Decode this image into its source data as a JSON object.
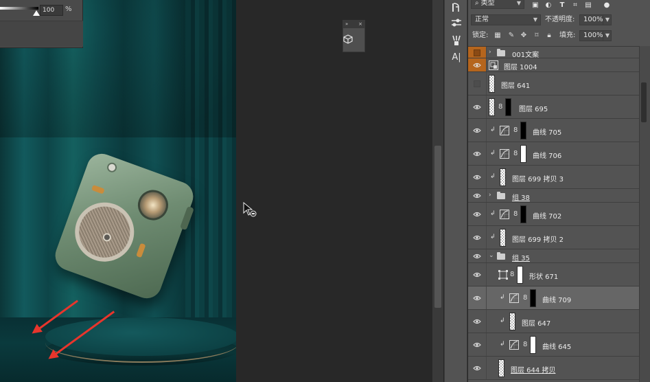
{
  "options_panel": {
    "value": "100",
    "unit": "%"
  },
  "layers_panel": {
    "filter_kind": "类型",
    "blend_mode": "正常",
    "opacity_label": "不透明度:",
    "opacity_value": "100%",
    "lock_label": "锁定:",
    "fill_label": "填充:",
    "fill_value": "100%",
    "layers": [
      {
        "name": "001文案",
        "kind": "group",
        "visible": false,
        "expanded": false,
        "tinted": true
      },
      {
        "name": "图层 1004",
        "kind": "smart",
        "visible": true,
        "tinted": true
      },
      {
        "name": "图层 641",
        "kind": "pixel",
        "visible": false
      },
      {
        "name": "图层 695",
        "kind": "pixel-mask",
        "visible": true
      },
      {
        "name": "曲线 705",
        "kind": "curves",
        "visible": true,
        "mask": "black",
        "clipped": true
      },
      {
        "name": "曲线 706",
        "kind": "curves",
        "visible": true,
        "mask": "white",
        "clipped": true
      },
      {
        "name": "图层 699 拷贝 3",
        "kind": "pixel",
        "visible": true,
        "clipped": true
      },
      {
        "name": "组 38",
        "kind": "group",
        "visible": true,
        "expanded": false,
        "underline": true
      },
      {
        "name": "曲线 702",
        "kind": "curves",
        "visible": true,
        "mask": "black",
        "clipped": true
      },
      {
        "name": "图层 699 拷贝 2",
        "kind": "pixel",
        "visible": true,
        "clipped": true
      },
      {
        "name": "组 35",
        "kind": "group",
        "visible": true,
        "expanded": true,
        "underline": true
      },
      {
        "name": "形状 671",
        "kind": "shape",
        "visible": true
      },
      {
        "name": "曲线 709",
        "kind": "curves",
        "visible": true,
        "mask": "black",
        "clipped": true,
        "selected": true
      },
      {
        "name": "图层 647",
        "kind": "pixel",
        "visible": true,
        "clipped": true
      },
      {
        "name": "曲线 645",
        "kind": "curves",
        "visible": true,
        "mask": "white",
        "clipped": true
      },
      {
        "name": "图层 644 拷贝",
        "kind": "pixel",
        "visible": true,
        "underline": true
      }
    ]
  },
  "icons": {
    "tool_strip": [
      "history-brush-icon",
      "adjust-sliders-icon",
      "brush-presets-icon",
      "character-icon"
    ],
    "filter": [
      "pixel-filter-icon",
      "adjustment-filter-icon",
      "type-filter-icon",
      "shape-filter-icon",
      "smart-object-filter-icon",
      "filter-toggle-icon"
    ],
    "lock": [
      "lock-pixels-icon",
      "lock-image-icon",
      "lock-position-icon",
      "lock-artboard-icon",
      "lock-all-icon"
    ]
  },
  "colors": {
    "panel": "#535353",
    "selected_row": "#666666",
    "group_tint": "#b5651d",
    "arrow": "#e8352c"
  }
}
